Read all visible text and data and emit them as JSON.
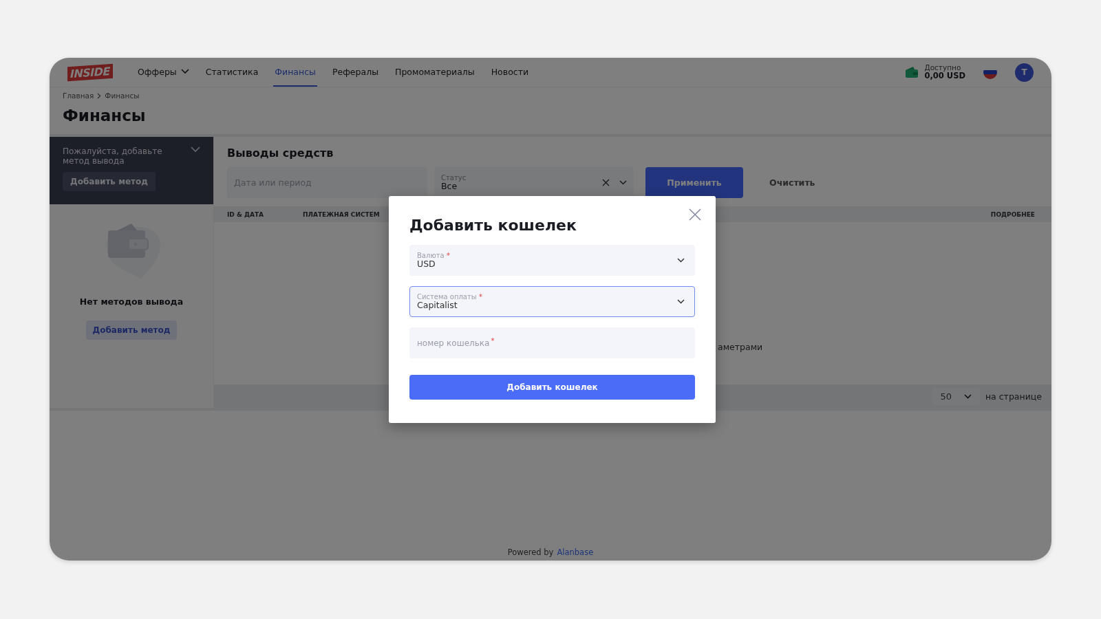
{
  "header": {
    "logo": "INSIDE",
    "nav": [
      {
        "label": "Офферы",
        "selected": false,
        "dropdown": true
      },
      {
        "label": "Статистика",
        "selected": false,
        "dropdown": false
      },
      {
        "label": "Финансы",
        "selected": true,
        "dropdown": false
      },
      {
        "label": "Рефералы",
        "selected": false,
        "dropdown": false
      },
      {
        "label": "Промоматериалы",
        "selected": false,
        "dropdown": false
      },
      {
        "label": "Новости",
        "selected": false,
        "dropdown": false
      }
    ],
    "balance": {
      "label": "Доступно",
      "amount": "0,00 USD"
    },
    "avatar": "T"
  },
  "breadcrumb": [
    "Главная",
    "Финансы"
  ],
  "page_title": "Финансы",
  "methods_panel": {
    "notice": "Пожалуйста, добавьте метод вывода",
    "add_button": "Добавить метод",
    "empty_text": "Нет методов вывода",
    "empty_button": "Добавить метод"
  },
  "withdrawals": {
    "title": "Выводы средств",
    "filters": {
      "date": {
        "placeholder": "Дата или период"
      },
      "status": {
        "label": "Статус",
        "value": "Все"
      },
      "apply": "Применить",
      "clear": "Очистить"
    },
    "columns": [
      "ID & ДАТА",
      "ПЛАТЕЖНАЯ СИСТЕМ",
      "ПОДРОБНЕЕ"
    ],
    "empty_text": "аметрами",
    "per_page": {
      "value": "50",
      "label": "на странице"
    }
  },
  "footer": {
    "text": "Powered by",
    "link": "Alanbase"
  },
  "modal": {
    "title": "Добавить кошелек",
    "fields": [
      {
        "kind": "select",
        "label": "Валюта",
        "required_mark": "*",
        "value": "USD",
        "focused": false
      },
      {
        "kind": "select",
        "label": "Система оплаты",
        "required_mark": "*",
        "value": "Capitalist",
        "focused": true
      },
      {
        "kind": "input",
        "placeholder": "номер кошелька",
        "required_mark": "*",
        "focused": false
      }
    ],
    "submit": "Добавить кошелек"
  }
}
